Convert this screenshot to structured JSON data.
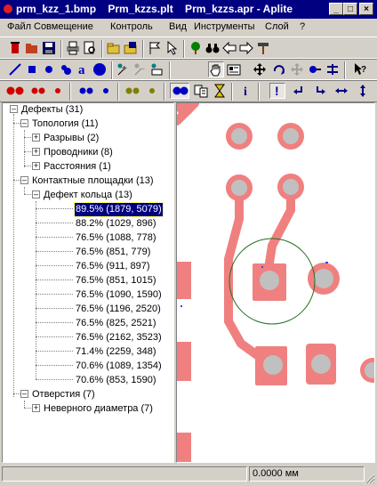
{
  "window": {
    "title": "prm_kzz_1.bmp    Prm_kzzs.plt    Prm_kzzs.apr - Aplite",
    "controls": {
      "minimize": "_",
      "maximize": "□",
      "close": "×"
    }
  },
  "menu": [
    {
      "label": "Файл"
    },
    {
      "label": "Совмещение"
    },
    {
      "label": "Контроль"
    },
    {
      "label": "Вид"
    },
    {
      "label": "Инструменты"
    },
    {
      "label": "Слой"
    },
    {
      "label": "?"
    }
  ],
  "toolbar_icons": {
    "row1": [
      "delete-icon",
      "open-icon",
      "save-icon",
      "print-icon",
      "print-preview-icon",
      "open-folder-icon",
      "save-folder-icon",
      "flag-icon",
      "pointer-icon",
      "tree-icon",
      "binoculars-icon",
      "arrow-left-icon",
      "arrow-right-icon",
      "hammer-icon"
    ],
    "row2": [
      "line-tool-icon",
      "rect-tool-icon",
      "circle-tool-icon",
      "shape-tool-icon",
      "text-tool-icon",
      "big-circle-tool-icon",
      "add-point-icon",
      "remove-point-icon",
      "edit-point-icon",
      "hand-icon",
      "info-card-icon",
      "move-icon",
      "rotate-icon",
      "move-gray-icon",
      "align-icon",
      "split-icon",
      "help-pointer-icon"
    ],
    "row3": [
      "red-pair-large-icon",
      "red-pair-medium-icon",
      "red-dot-icon",
      "blue-pair-icon",
      "blue-dot-icon",
      "olive-pair-icon",
      "olive-dot-icon",
      "blue-pair-selected-icon",
      "compare-icon",
      "hourglass-icon",
      "info-icon",
      "exclamation-icon",
      "turn-left-icon",
      "turn-right-icon",
      "horizontal-arrows-icon",
      "vertical-arrows-icon"
    ]
  },
  "tree": {
    "root": "Дефекты (31)",
    "topology": "Топология (11)",
    "breaks": "Разрывы (2)",
    "conductors": "Проводники (8)",
    "distances": "Расстояния (1)",
    "pads": "Контактные площадки (13)",
    "ring_defect": "Дефект кольца (13)",
    "ring_items": [
      "89.5% (1879, 5079)",
      "88.2% (1029, 896)",
      "76.5% (1088, 778)",
      "76.5% (851, 779)",
      "76.5% (911, 897)",
      "76.5% (851, 1015)",
      "76.5% (1090, 1590)",
      "76.5% (1196, 2520)",
      "76.5% (825, 2521)",
      "76.5% (2162, 3523)",
      "71.4% (2259, 348)",
      "70.6% (1089, 1354)",
      "70.6% (853, 1590)"
    ],
    "holes": "Отверстия (7)",
    "wrong_diameter": "Неверного диаметра (7)"
  },
  "status": {
    "coordinate": "0.0000 мм"
  },
  "colors": {
    "titlebar": "#000080",
    "pad": "#f08080",
    "hole": "#c0c0c0",
    "circle": "#207020"
  }
}
